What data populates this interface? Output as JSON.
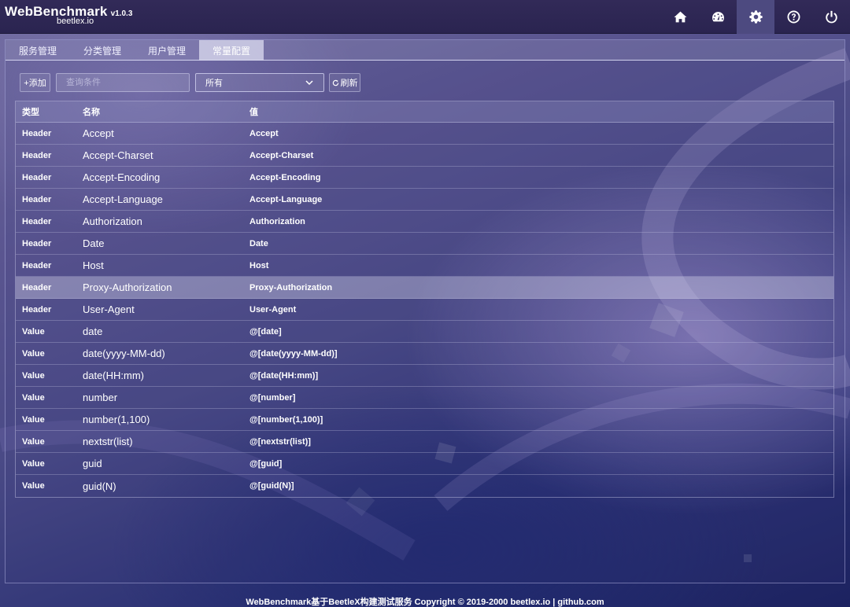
{
  "app": {
    "title": "WebBenchmark",
    "version": "v1.0.3",
    "subtitle": "beetlex.io"
  },
  "nav": [
    {
      "icon": "home-icon"
    },
    {
      "icon": "dashboard-icon"
    },
    {
      "icon": "settings-icon",
      "active": true
    },
    {
      "icon": "help-icon"
    },
    {
      "icon": "power-icon"
    }
  ],
  "tabs": [
    {
      "label": "服务管理"
    },
    {
      "label": "分类管理"
    },
    {
      "label": "用户管理"
    },
    {
      "label": "常量配置",
      "active": true
    }
  ],
  "toolbar": {
    "add_label": "+添加",
    "search_placeholder": "查询条件",
    "filter_value": "所有",
    "refresh_label": "刷新"
  },
  "table": {
    "columns": [
      "类型",
      "名称",
      "值"
    ],
    "rows": [
      {
        "type": "Header",
        "name": "Accept",
        "value": "Accept"
      },
      {
        "type": "Header",
        "name": "Accept-Charset",
        "value": "Accept-Charset"
      },
      {
        "type": "Header",
        "name": "Accept-Encoding",
        "value": "Accept-Encoding"
      },
      {
        "type": "Header",
        "name": "Accept-Language",
        "value": "Accept-Language"
      },
      {
        "type": "Header",
        "name": "Authorization",
        "value": "Authorization"
      },
      {
        "type": "Header",
        "name": "Date",
        "value": "Date"
      },
      {
        "type": "Header",
        "name": "Host",
        "value": "Host"
      },
      {
        "type": "Header",
        "name": "Proxy-Authorization",
        "value": "Proxy-Authorization",
        "selected": true
      },
      {
        "type": "Header",
        "name": "User-Agent",
        "value": "User-Agent"
      },
      {
        "type": "Value",
        "name": "date",
        "value": "@[date]"
      },
      {
        "type": "Value",
        "name": "date(yyyy-MM-dd)",
        "value": "@[date(yyyy-MM-dd)]"
      },
      {
        "type": "Value",
        "name": "date(HH:mm)",
        "value": "@[date(HH:mm)]"
      },
      {
        "type": "Value",
        "name": "number",
        "value": "@[number]"
      },
      {
        "type": "Value",
        "name": "number(1,100)",
        "value": "@[number(1,100)]"
      },
      {
        "type": "Value",
        "name": "nextstr(list)",
        "value": "@[nextstr(list)]"
      },
      {
        "type": "Value",
        "name": "guid",
        "value": "@[guid]"
      },
      {
        "type": "Value",
        "name": "guid(N)",
        "value": "@[guid(N)]"
      }
    ]
  },
  "footer": "WebBenchmark基于BeetleX构建测试服务 Copyright © 2019-2000 beetlex.io | github.com"
}
